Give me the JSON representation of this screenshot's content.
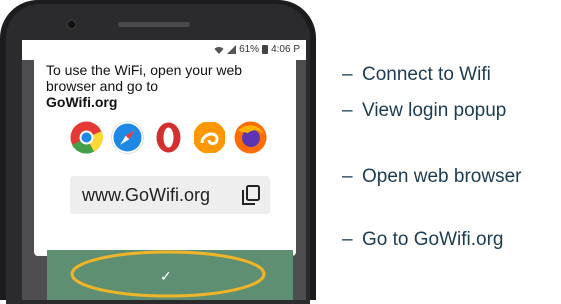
{
  "status_bar": {
    "battery": "61%",
    "time": "4:06 P"
  },
  "instructions": {
    "text": "To use the WiFi, open your web browser and go to",
    "site": "GoWifi.org"
  },
  "browsers": [
    {
      "icon": "chrome-icon",
      "color": "#e53935"
    },
    {
      "icon": "safari-icon",
      "color": "#1e88e5"
    },
    {
      "icon": "opera-icon",
      "color": "#d32f2f"
    },
    {
      "icon": "uc-browser-icon",
      "color": "#ff9800"
    },
    {
      "icon": "firefox-icon",
      "color": "#ff6d00"
    }
  ],
  "url_box": {
    "url": "www.GoWifi.org"
  },
  "confirm_button": {
    "label": "✓",
    "color": "#5f8f73"
  },
  "highlight_color": "#f0b429",
  "steps": [
    {
      "dash": "–",
      "text": "Connect to Wifi"
    },
    {
      "dash": "–",
      "text": "View login popup"
    },
    {
      "dash": "–",
      "text": "Open web browser"
    },
    {
      "dash": "–",
      "text": "Go to GoWifi.org"
    }
  ]
}
